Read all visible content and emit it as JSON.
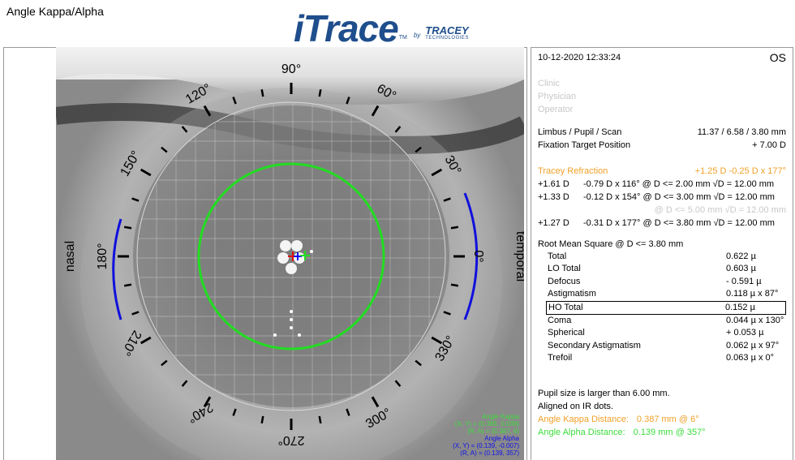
{
  "header": {
    "title": "Angle Kappa/Alpha",
    "logo_main": "iTrace",
    "logo_tm": "TM",
    "logo_by": "by",
    "logo_company": "TRACEY",
    "logo_company_sub": "TECHNOLOGIES"
  },
  "eye_view": {
    "labels": {
      "nasal": "nasal",
      "temporal": "temporal"
    },
    "angles": [
      "90°",
      "60°",
      "30°",
      "0°",
      "330°",
      "300°",
      "270°",
      "240°",
      "210°",
      "180°",
      "150°",
      "120°"
    ],
    "overlay": {
      "kappa_title": "Angle Kappa",
      "kappa_xy": "(X, Y) = (0.385, 0.038)",
      "kappa_ra": "(R, A) = (0.387, 6)",
      "alpha_title": "Angle Alpha",
      "alpha_xy": "(X, Y) = (0.139, -0.007)",
      "alpha_ra": "(R, A) = (0.139, 357)"
    }
  },
  "info": {
    "datetime": "10-12-2020  12:33:24",
    "eye": "OS",
    "clinic": "Clinic",
    "physician": "Physician",
    "operator": "Operator",
    "limbus_label": "Limbus / Pupil / Scan",
    "limbus_value": "11.37 / 6.58 / 3.80 mm",
    "fixation_label": "Fixation Target Position",
    "fixation_value": "+ 7.00 D",
    "refraction_label": "Tracey Refraction",
    "refraction_value": "+1.25 D -0.25 D x 177°",
    "refraction_rows": [
      {
        "a": "+1.61 D",
        "b": "-0.79 D x 116° @ D <= 2.00 mm √D = 12.00 mm"
      },
      {
        "a": "+1.33 D",
        "b": "-0.12 D x 154° @ D <= 3.00 mm √D = 12.00 mm"
      },
      {
        "a": "",
        "b": "@ D <= 5.00 mm √D = 12.00 mm"
      },
      {
        "a": "+1.27 D",
        "b": "-0.31 D x 177° @ D <= 3.80 mm √D = 12.00 mm"
      }
    ],
    "rms_title": "Root Mean Square @ D <= 3.80 mm",
    "rms_rows": [
      {
        "k": "Total",
        "v": "0.622 µ"
      },
      {
        "k": "LO Total",
        "v": "0.603 µ"
      },
      {
        "k": "Defocus",
        "v": "- 0.591 µ"
      },
      {
        "k": "Astigmatism",
        "v": "0.118 µ x   87°"
      },
      {
        "k": "HO Total",
        "v": "0.152 µ"
      },
      {
        "k": "Coma",
        "v": "0.044 µ x 130°"
      },
      {
        "k": "Spherical",
        "v": "+ 0.053 µ"
      },
      {
        "k": "Secondary Astigmatism",
        "v": "0.062 µ x   97°"
      },
      {
        "k": "Trefoil",
        "v": "0.063 µ x     0°"
      }
    ],
    "pupil_note": "Pupil size is larger than 6.00 mm.",
    "aligned_note": "Aligned on IR dots.",
    "kappa_label": "Angle Kappa Distance:",
    "kappa_value": "0.387 mm @ 6°",
    "alpha_label": "Angle Alpha Distance:",
    "alpha_value": "0.139 mm @ 357°"
  },
  "colors": {
    "green": "#22dd22",
    "blue": "#1010dd",
    "orange": "#f0a028"
  }
}
